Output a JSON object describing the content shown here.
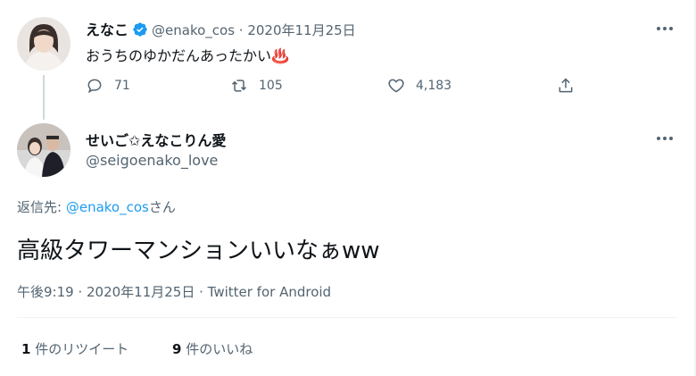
{
  "tweet1": {
    "display_name": "えなこ",
    "handle_date": "@enako_cos · 2020年11月25日",
    "text": "おうちのゆかだんあったかい♨️",
    "reply_count": "71",
    "retweet_count": "105",
    "like_count": "4,183"
  },
  "tweet2": {
    "display_name": "せいご✩えなこりん愛",
    "handle": "@seigoenako_love",
    "reply_label": "返信先:",
    "reply_mention": "@enako_cos",
    "reply_suffix": "さん",
    "text": "高級タワーマンションいいなぁww",
    "meta": "午後9:19 · 2020年11月25日 · Twitter for Android",
    "retweets_num": "1",
    "retweets_label": "件のリツイート",
    "likes_num": "9",
    "likes_label": "件のいいね"
  },
  "colors": {
    "accent": "#1d9bf0",
    "muted": "#536471",
    "text": "#0f1419",
    "divider": "#eff3f4"
  },
  "icons": [
    "verified-badge-icon",
    "more-icon",
    "reply-icon",
    "retweet-icon",
    "like-icon",
    "share-icon"
  ]
}
